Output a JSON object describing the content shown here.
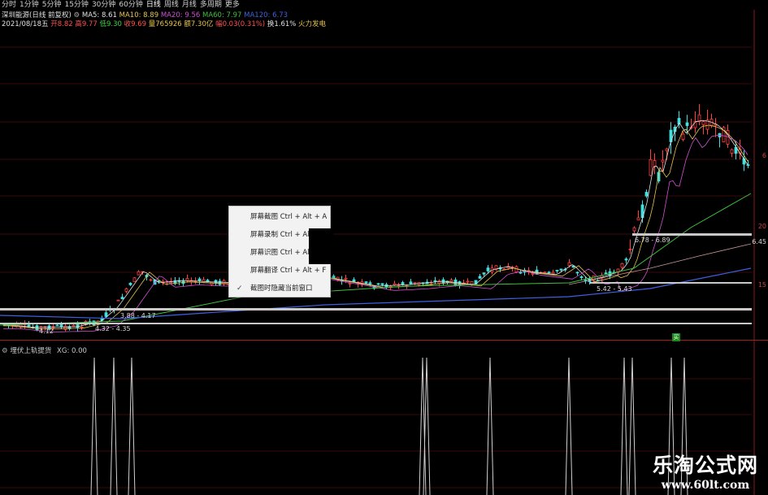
{
  "toolbar": {
    "items": [
      {
        "label": "分时"
      },
      {
        "label": "1分钟"
      },
      {
        "label": "5分钟"
      },
      {
        "label": "15分钟"
      },
      {
        "label": "30分钟"
      },
      {
        "label": "60分钟"
      },
      {
        "label": "日线"
      },
      {
        "label": "周线"
      },
      {
        "label": "月线"
      },
      {
        "label": "多周期"
      },
      {
        "label": "更多"
      }
    ]
  },
  "info": {
    "stock": "深圳能源(日线 前复权)",
    "ma5": "MA5: 8.61",
    "ma10": "MA10: 8.89",
    "ma20": "MA20: 9.56",
    "ma60": "MA60: 7.97",
    "ma120": "MA120: 6.73",
    "date": "2021/08/18五",
    "open": "开8.82",
    "high": "高9.77",
    "low": "低9.30",
    "close": "收9.69",
    "volume": "量765926",
    "amount": "额7.30亿",
    "change": "幅0.03(0.31%)",
    "turnover": "换1.61%",
    "sector": "火力发电"
  },
  "colors": {
    "ma5": "#e0e0e0",
    "ma10": "#e6c34a",
    "ma20": "#d050d0",
    "ma60": "#40c040",
    "ma120": "#4060e0",
    "up": "#ff4040",
    "down": "#40e0e0"
  },
  "zones": {
    "z1": "6.78 - 6.89",
    "z2": "5.42 - 5.43",
    "z3": "3.88 - 4.17",
    "z4": "4.12",
    "z5": "4.32 - 4.35"
  },
  "axis": {
    "a1": "6",
    "a2": "20",
    "a3": "6.45",
    "a4": "15"
  },
  "context_menu": {
    "items": [
      {
        "label": "屏幕截图 Ctrl + Alt + A",
        "checked": false
      },
      {
        "label": "屏幕录制 Ctrl + Alt + S",
        "checked": false
      },
      {
        "label": "屏幕识图 Ctrl + Alt",
        "checked": false
      },
      {
        "label": "屏幕翻译 Ctrl + Alt + F",
        "checked": false
      },
      {
        "label": "截图时隐藏当前窗口",
        "checked": true
      }
    ]
  },
  "signal": {
    "badge": "买"
  },
  "subchart": {
    "title": "埋伏上轨提货",
    "value": "XG: 0.00"
  },
  "watermark": {
    "title": "乐淘公式网",
    "url": "www.60lt.com"
  }
}
